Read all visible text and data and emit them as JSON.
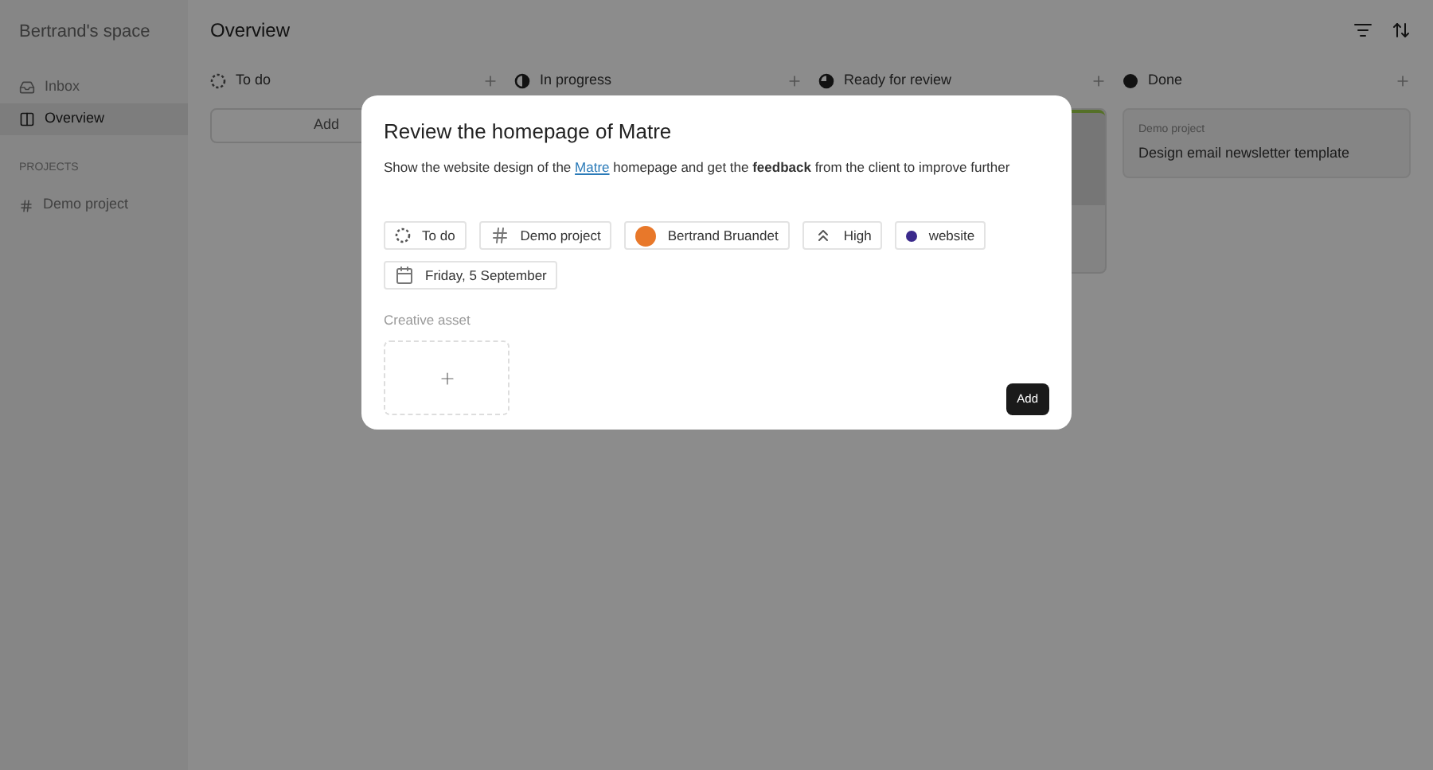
{
  "sidebar": {
    "workspace": "Bertrand's space",
    "items": [
      {
        "label": "Inbox",
        "kind": "inbox",
        "selected": false
      },
      {
        "label": "Overview",
        "kind": "board",
        "selected": true
      }
    ],
    "section_title": "PROJECTS",
    "projects": [
      {
        "label": "Demo project"
      }
    ]
  },
  "header": {
    "title": "Overview"
  },
  "columns": [
    {
      "title": "To do",
      "kind": "todo",
      "add_label": "Add"
    },
    {
      "title": "In progress",
      "kind": "progress"
    },
    {
      "title": "Ready for review",
      "kind": "review",
      "cards": [
        {
          "kind": "image"
        }
      ]
    },
    {
      "title": "Done",
      "kind": "done",
      "cards": [
        {
          "kind": "text",
          "project": "Demo project",
          "title": "Design email newsletter template"
        }
      ]
    }
  ],
  "modal": {
    "title": "Review the homepage of Matre",
    "description_before": "Show the website design of the",
    "description_link": "Matre",
    "description_after": "homepage and get the **feedback** from the client to improve further",
    "chips": [
      {
        "kind": "status",
        "label": "To do"
      },
      {
        "kind": "project",
        "label": "Demo project"
      },
      {
        "kind": "assignee",
        "label": "Bertrand Bruandet"
      },
      {
        "kind": "priority",
        "label": "High"
      },
      {
        "kind": "tag",
        "label": "website",
        "color": "#3b2a8c"
      },
      {
        "kind": "date",
        "label": "Friday, 5 September"
      }
    ],
    "asset_label": "Creative asset",
    "add_button": "Add"
  }
}
